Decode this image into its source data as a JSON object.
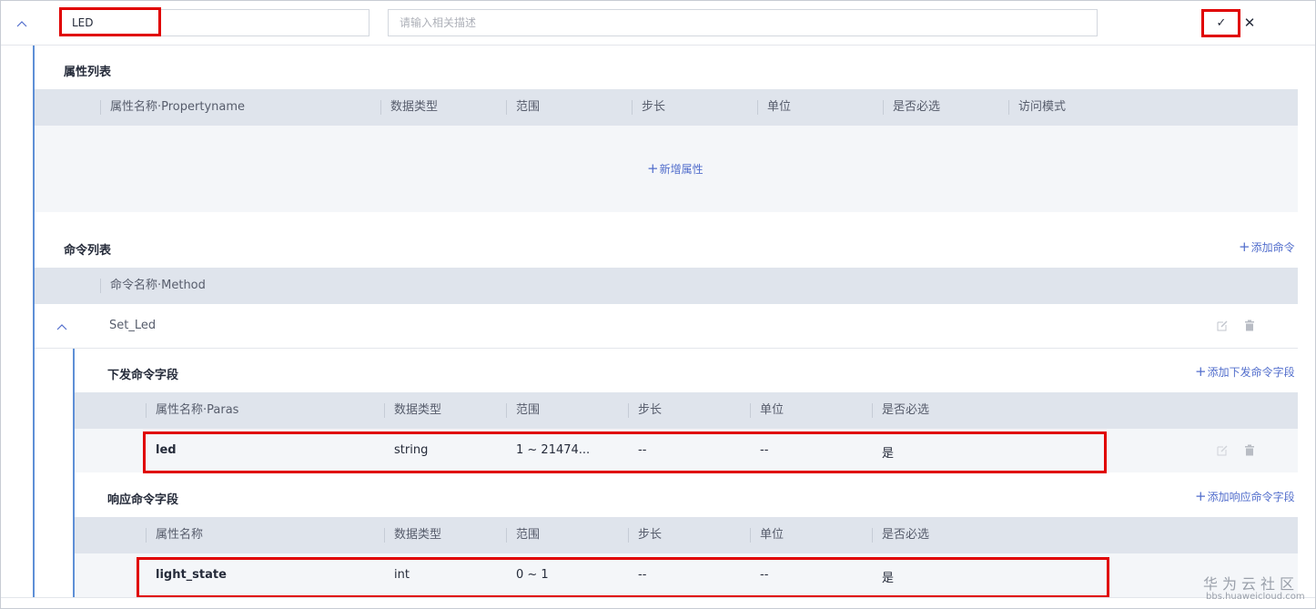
{
  "header": {
    "name_value": "LED",
    "desc_placeholder": "请输入相关描述",
    "confirm_label": "✓",
    "close_label": "✕"
  },
  "properties": {
    "title": "属性列表",
    "columns": [
      "属性名称·Propertyname",
      "数据类型",
      "范围",
      "步长",
      "单位",
      "是否必选",
      "访问模式"
    ],
    "add_label": "新增属性"
  },
  "commands": {
    "title": "命令列表",
    "add_label": "添加命令",
    "column": "命令名称·Method",
    "items": [
      {
        "name": "Set_Led",
        "downlink": {
          "title": "下发命令字段",
          "add_label": "添加下发命令字段",
          "columns": [
            "属性名称·Paras",
            "数据类型",
            "范围",
            "步长",
            "单位",
            "是否必选"
          ],
          "rows": [
            {
              "name": "led",
              "type": "string",
              "range": "1 ~ 21474...",
              "step": "--",
              "unit": "--",
              "required": "是"
            }
          ]
        },
        "response": {
          "title": "响应命令字段",
          "add_label": "添加响应命令字段",
          "columns": [
            "属性名称",
            "数据类型",
            "范围",
            "步长",
            "单位",
            "是否必选"
          ],
          "rows": [
            {
              "name": "light_state",
              "type": "int",
              "range": "0 ~ 1",
              "step": "--",
              "unit": "--",
              "required": "是"
            }
          ]
        }
      }
    ]
  },
  "watermark": {
    "title": "华为云社区",
    "url": "bbs.huaweicloud.com"
  },
  "colors": {
    "accent": "#526ecc",
    "highlight": "#e00000",
    "header_bg": "#dfe4ec"
  }
}
